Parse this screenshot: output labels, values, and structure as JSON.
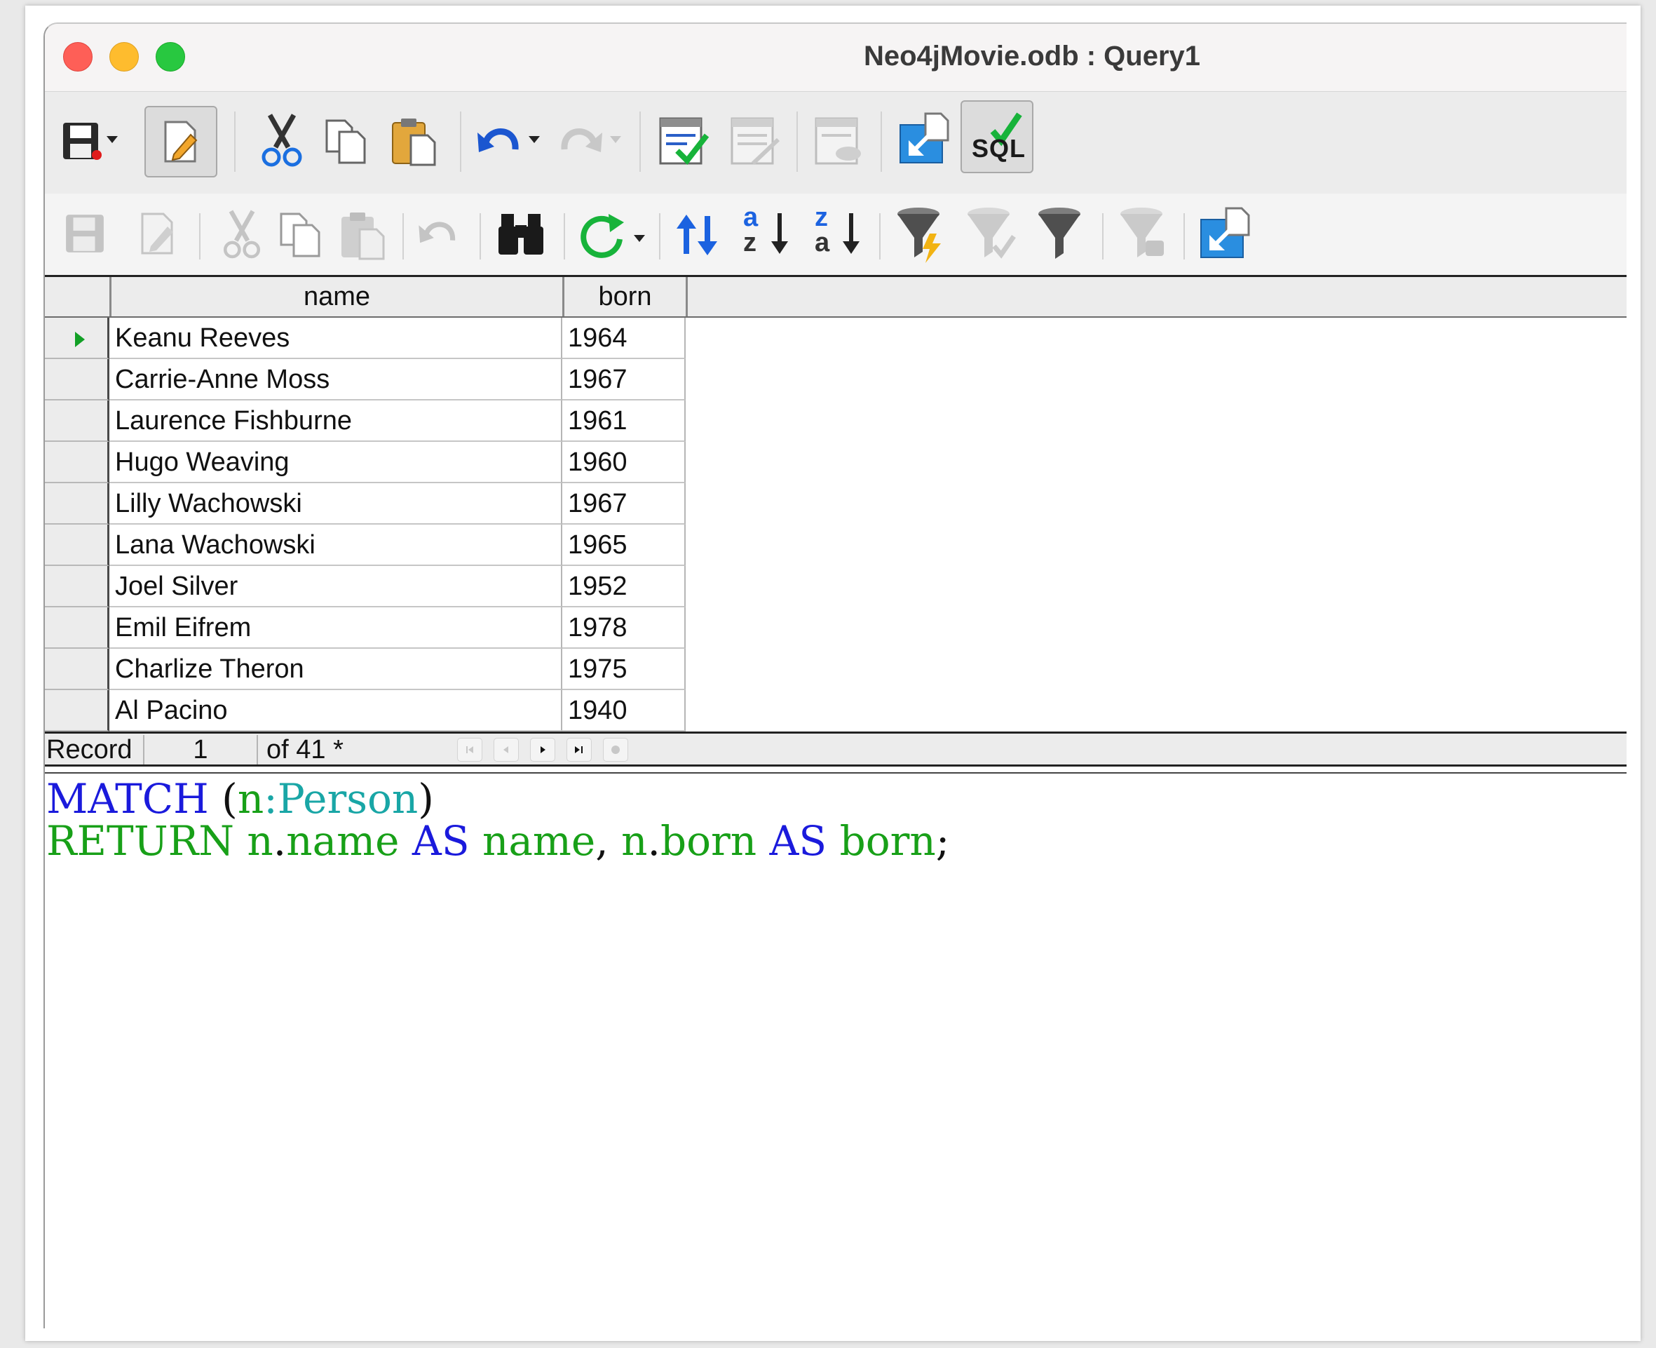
{
  "window": {
    "title": "Neo4jMovie.odb : Query1"
  },
  "toolbar_primary": {
    "items": [
      "save-icon",
      "edit-icon",
      "cut-icon",
      "copy-icon",
      "paste-icon",
      "undo-icon",
      "redo-icon",
      "run-query-icon",
      "clear-query-icon",
      "design-view-icon",
      "data-source-icon",
      "run-sql-directly-icon"
    ],
    "sql_label": "SQL"
  },
  "toolbar_secondary": {
    "items": [
      "save-record-icon",
      "edit-data-icon",
      "cut-icon",
      "copy-icon",
      "paste-icon",
      "undo-icon",
      "find-record-icon",
      "refresh-icon",
      "sort-icon",
      "sort-ascending-icon",
      "sort-descending-icon",
      "autofilter-icon",
      "apply-filter-icon",
      "standard-filter-icon",
      "reset-filter-icon",
      "data-to-text-icon"
    ],
    "sort_asc_glyph_top": "a",
    "sort_asc_glyph_bottom": "z",
    "sort_desc_glyph_top": "z",
    "sort_desc_glyph_bottom": "a"
  },
  "grid": {
    "columns": [
      "name",
      "born"
    ],
    "rows": [
      {
        "name": "Keanu Reeves",
        "born": "1964"
      },
      {
        "name": "Carrie-Anne Moss",
        "born": "1967"
      },
      {
        "name": "Laurence Fishburne",
        "born": "1961"
      },
      {
        "name": "Hugo Weaving",
        "born": "1960"
      },
      {
        "name": "Lilly Wachowski",
        "born": "1967"
      },
      {
        "name": "Lana Wachowski",
        "born": "1965"
      },
      {
        "name": "Joel Silver",
        "born": "1952"
      },
      {
        "name": "Emil Eifrem",
        "born": "1978"
      },
      {
        "name": "Charlize Theron",
        "born": "1975"
      },
      {
        "name": "Al Pacino",
        "born": "1940"
      }
    ]
  },
  "record_bar": {
    "label": "Record",
    "current": "1",
    "of_text": "of 41 *"
  },
  "editor": {
    "line1": [
      {
        "t": "MATCH",
        "c": "kw"
      },
      {
        "t": " (",
        "c": "pn"
      },
      {
        "t": "n",
        "c": "id"
      },
      {
        "t": ":Person",
        "c": "lbl"
      },
      {
        "t": ")",
        "c": "pn"
      }
    ],
    "line2": [
      {
        "t": "RETURN",
        "c": "id"
      },
      {
        "t": " n",
        "c": "id"
      },
      {
        "t": ".",
        "c": "pn"
      },
      {
        "t": "name",
        "c": "id"
      },
      {
        "t": " AS",
        "c": "kw"
      },
      {
        "t": " name",
        "c": "id"
      },
      {
        "t": ", ",
        "c": "pn"
      },
      {
        "t": "n",
        "c": "id"
      },
      {
        "t": ".",
        "c": "pn"
      },
      {
        "t": "born",
        "c": "id"
      },
      {
        "t": " AS",
        "c": "kw"
      },
      {
        "t": " born",
        "c": "id"
      },
      {
        "t": ";",
        "c": "pn"
      }
    ]
  },
  "colors": {
    "keyword": "#1a1adc",
    "identifier": "#18a018",
    "label": "#19a6a6",
    "close": "#fe5f57",
    "minimize": "#febc2e",
    "maximize": "#28c840"
  }
}
